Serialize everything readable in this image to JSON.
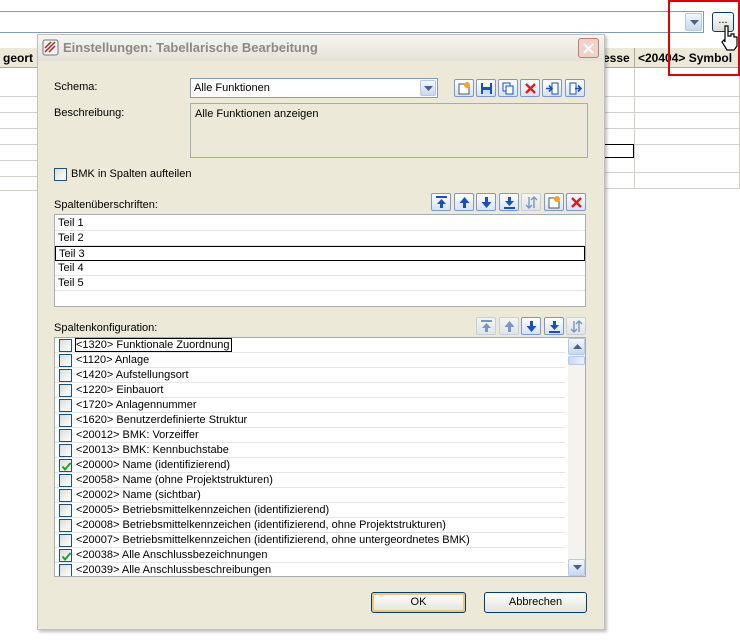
{
  "background": {
    "ellipsis_label": "...",
    "headers": [
      "geort (",
      "esse",
      "<20404> Symbol"
    ]
  },
  "dialog": {
    "title": "Einstellungen: Tabellarische Bearbeitung",
    "schema_label": "Schema:",
    "schema_value": "Alle Funktionen",
    "description_label": "Beschreibung:",
    "description_value": "Alle Funktionen anzeigen",
    "split_bmk_label": "BMK in Spalten aufteilen",
    "split_bmk_checked": false,
    "headings_label": "Spaltenüberschriften:",
    "headings": [
      "Teil 1",
      "Teil 2",
      "Teil 3",
      "Teil 4",
      "Teil 5"
    ],
    "headings_focused_index": 2,
    "config_label": "Spaltenkonfiguration:",
    "config_items": [
      {
        "label": "<1320> Funktionale Zuordnung",
        "checked": false
      },
      {
        "label": "<1120> Anlage",
        "checked": false
      },
      {
        "label": "<1420> Aufstellungsort",
        "checked": false
      },
      {
        "label": "<1220> Einbauort",
        "checked": false
      },
      {
        "label": "<1720> Anlagennummer",
        "checked": false
      },
      {
        "label": "<1620> Benutzerdefinierte Struktur",
        "checked": false
      },
      {
        "label": "<20012> BMK: Vorzeiffer",
        "checked": false
      },
      {
        "label": "<20013> BMK: Kennbuchstabe",
        "checked": false
      },
      {
        "label": "<20000> Name (identifizierend)",
        "checked": true
      },
      {
        "label": "<20058> Name (ohne Projektstrukturen)",
        "checked": false
      },
      {
        "label": "<20002> Name (sichtbar)",
        "checked": false
      },
      {
        "label": "<20005> Betriebsmittelkennzeichen (identifizierend)",
        "checked": false
      },
      {
        "label": "<20008> Betriebsmittelkennzeichen (identifizierend, ohne Projektstrukturen)",
        "checked": false
      },
      {
        "label": "<20007> Betriebsmittelkennzeichen (identifizierend, ohne untergeordnetes BMK)",
        "checked": false
      },
      {
        "label": "<20038> Alle Anschlussbezeichnungen",
        "checked": true
      },
      {
        "label": "<20039> Alle Anschlussbeschreibungen",
        "checked": false
      }
    ],
    "ok_label": "OK",
    "cancel_label": "Abbrechen"
  },
  "icons": {
    "schema_toolbar": [
      "new-icon",
      "save-icon",
      "copy-icon",
      "delete-icon",
      "import-icon",
      "export-icon"
    ],
    "headings_toolbar": [
      "move-top-icon",
      "move-up-icon",
      "move-down-icon",
      "move-bottom-icon",
      "sort-icon",
      "new-icon",
      "delete-icon"
    ],
    "config_toolbar": [
      "move-top-icon",
      "move-up-icon",
      "move-down-icon",
      "move-bottom-icon",
      "sort-icon"
    ]
  },
  "colors": {
    "dialog_bg": "#ece9d8",
    "button_border": "#003c74",
    "delete_red": "#d81e1e",
    "toolbar_blue": "#1a4fbf",
    "highlight_red": "#e00000",
    "check_green": "#21a121"
  }
}
